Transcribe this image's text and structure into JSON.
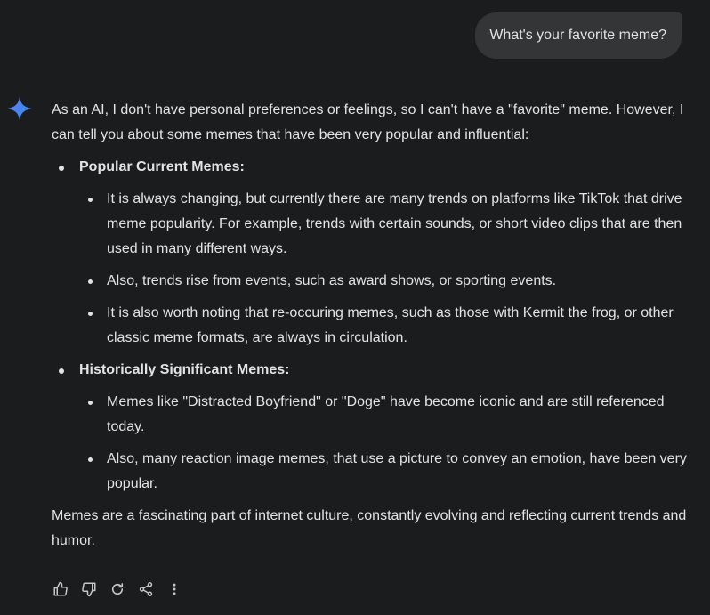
{
  "user_message": "What's your favorite meme?",
  "response": {
    "intro": "As an AI, I don't have personal preferences or feelings, so I can't have a \"favorite\" meme. However, I can tell you about some memes that have been very popular and influential:",
    "sections": [
      {
        "heading": "Popular Current Memes:",
        "items": [
          "It is always changing, but currently there are many trends on platforms like TikTok that drive meme popularity. For example, trends with certain sounds, or short video clips that are then used in many different ways.",
          "Also, trends rise from events, such as award shows, or sporting events.",
          "It is also worth noting that re-occuring memes, such as those with Kermit the frog, or other classic meme formats, are always in circulation."
        ]
      },
      {
        "heading": "Historically Significant Memes:",
        "items": [
          "Memes like \"Distracted Boyfriend\" or \"Doge\" have become iconic and are still referenced today.",
          "Also, many reaction image memes, that use a picture to convey an emotion, have been very popular."
        ]
      }
    ],
    "outro": "Memes are a fascinating part of internet culture, constantly evolving and reflecting current trends and humor."
  },
  "actions": [
    {
      "icon": "thumbs-up-icon"
    },
    {
      "icon": "thumbs-down-icon"
    },
    {
      "icon": "regenerate-icon"
    },
    {
      "icon": "share-icon"
    },
    {
      "icon": "more-vert-icon"
    }
  ],
  "colors": {
    "background": "#1b1c1d",
    "user_bubble": "#333537",
    "text": "#e3e3e3",
    "icon": "#c4c7c5",
    "sparkle_start": "#4285f4",
    "sparkle_end": "#9b72cb"
  }
}
